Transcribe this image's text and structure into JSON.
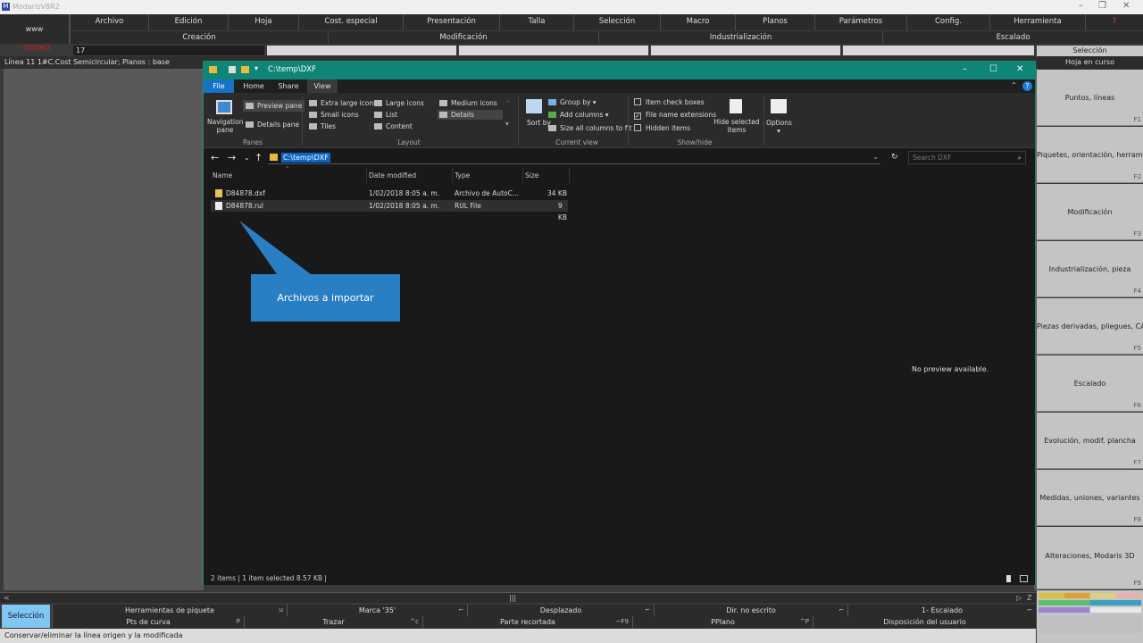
{
  "app": {
    "title": "ModarisV8R2"
  },
  "menu1": [
    "Archivo",
    "Edición",
    "Hoja",
    "Cost. especial",
    "Presentación",
    "Talla",
    "Selección",
    "Macro",
    "Planos",
    "Parámetros",
    "Config.",
    "Herramienta"
  ],
  "menu2": [
    "Creación",
    "Modificación",
    "Industrialización",
    "Escalado"
  ],
  "www_label": "www",
  "row3": {
    "red_text": "000063",
    "field_value": "17"
  },
  "info_line": "Línea 11 1#C.Cost   Semicircular;    Planos :  base",
  "sidebar": {
    "head1": "Selección",
    "head2": "Hoja en curso",
    "items": [
      {
        "label": "Puntos, líneas",
        "key": "F1"
      },
      {
        "label": "Piquetes, orientación, herramientas",
        "key": "F2"
      },
      {
        "label": "Modificación",
        "key": "F3"
      },
      {
        "label": "Industrialización, pieza",
        "key": "F4"
      },
      {
        "label": "Piezas derivadas, pliegues, CAD",
        "key": "F5"
      },
      {
        "label": "Escalado",
        "key": "F6"
      },
      {
        "label": "Evolución, modif. plancha",
        "key": "F7"
      },
      {
        "label": "Medidas, uniones, variantes",
        "key": "F8"
      },
      {
        "label": "Alteraciones, Modaris 3D",
        "key": "F9"
      }
    ]
  },
  "explorer": {
    "title_path": "C:\\temp\\DXF",
    "tabs": [
      "File",
      "Home",
      "Share",
      "View"
    ],
    "ribbon": {
      "nav_pane": "Navigation pane",
      "preview_pane": "Preview pane",
      "details_pane": "Details pane",
      "panes_group": "Panes",
      "layout_items": [
        "Extra large icons",
        "Large icons",
        "Medium icons",
        "Small icons",
        "List",
        "Details",
        "Tiles",
        "Content"
      ],
      "layout_group": "Layout",
      "sort_by": "Sort by",
      "group_by": "Group by",
      "add_columns": "Add columns",
      "size_all": "Size all columns to fit",
      "current_view_group": "Current view",
      "item_check_boxes": "Item check boxes",
      "file_name_extensions": "File name extensions",
      "hidden_items": "Hidden items",
      "hide_selected": "Hide selected items",
      "showhide_group": "Show/hide",
      "options": "Options"
    },
    "address": "C:\\temp\\DXF",
    "search_placeholder": "Search DXF",
    "columns": [
      "Name",
      "Date modified",
      "Type",
      "Size"
    ],
    "files": [
      {
        "name": "D84878.dxf",
        "date": "1/02/2018 8:05 a. m.",
        "type": "Archivo de AutoC...",
        "size": "34 KB"
      },
      {
        "name": "D84878.rul",
        "date": "1/02/2018 8:05 a. m.",
        "type": "RUL File",
        "size": "9 KB"
      }
    ],
    "callout": "Archivos a importar",
    "no_preview": "No preview available.",
    "status": "2 items   |   1 item selected  8.57 KB   |"
  },
  "bottom": {
    "selection_button": "Selección",
    "row1": [
      {
        "label": "Herramientas de piquete",
        "key": "u"
      },
      {
        "label": "Marca '35'",
        "key": "⌐"
      },
      {
        "label": "Desplazado",
        "key": "⌐"
      },
      {
        "label": "Dir. no escrito",
        "key": "⌐"
      },
      {
        "label": "1- Escalado",
        "key": "⌐"
      }
    ],
    "row2": [
      {
        "label": "Pts de curva",
        "key": "P"
      },
      {
        "label": "Trazar",
        "key": "^c"
      },
      {
        "label": "Parte recortada",
        "key": "~F9"
      },
      {
        "label": "PPlano",
        "key": "^P"
      },
      {
        "label": "Disposición del usuario",
        "key": ""
      }
    ],
    "status_line": "Conservar/eliminar la línea origen y la modificada"
  }
}
